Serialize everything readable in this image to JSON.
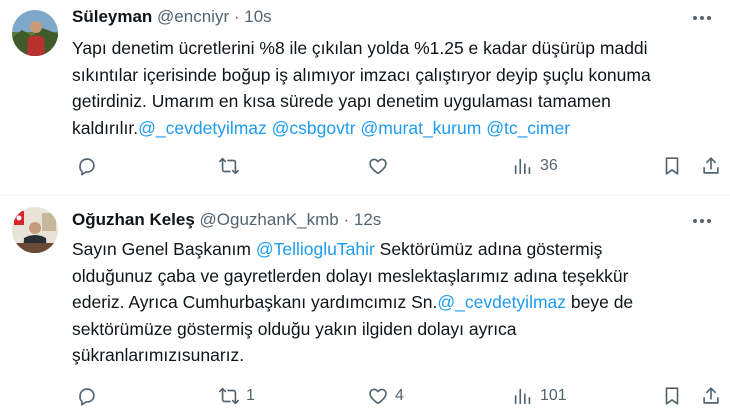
{
  "tweets": [
    {
      "name": "Süleyman",
      "handle": "@encniyr",
      "dot": "·",
      "time": "10s",
      "text_lines": [
        [
          {
            "t": "Yapı denetim ücretlerini %8 ile çıkılan yolda %1.25 e kadar düşürüp maddi"
          }
        ],
        [
          {
            "t": "sıkıntılar içerisinde boğup iş alımıyor imzacı çalıştıryor deyip şuçlu konuma"
          }
        ],
        [
          {
            "t": "getirdiniz. Umarım en kısa sürede yapı denetim uygulaması tamamen"
          }
        ],
        [
          {
            "t": "kaldırılır."
          },
          {
            "t": "@_cevdetyilmaz",
            "m": true
          },
          {
            "t": " "
          },
          {
            "t": "@csbgovtr",
            "m": true
          },
          {
            "t": " "
          },
          {
            "t": "@murat_kurum",
            "m": true
          },
          {
            "t": " "
          },
          {
            "t": "@tc_cimer",
            "m": true
          }
        ]
      ],
      "actions": {
        "reply_count": "",
        "retweet_count": "",
        "like_count": "",
        "views_count": "36"
      }
    },
    {
      "name": "Oğuzhan Keleş",
      "handle": "@OguzhanK_kmb",
      "dot": "·",
      "time": "12s",
      "text_lines": [
        [
          {
            "t": "Sayın Genel Başkanım "
          },
          {
            "t": "@TelliogluTahir",
            "m": true
          },
          {
            "t": " Sektörümüz adına göstermiş"
          }
        ],
        [
          {
            "t": "olduğunuz çaba ve gayretlerden dolayı meslektaşlarımız adına teşekkür"
          }
        ],
        [
          {
            "t": "ederiz. Ayrıca Cumhurbaşkanı yardımcımız Sn."
          },
          {
            "t": "@_cevdetyilmaz",
            "m": true
          },
          {
            "t": " beye de"
          }
        ],
        [
          {
            "t": "sektörümüze göstermiş olduğu yakın ilgiden dolayı ayrıca"
          }
        ],
        [
          {
            "t": "şükranlarımızısunarız."
          }
        ]
      ],
      "actions": {
        "reply_count": "",
        "retweet_count": "1",
        "like_count": "4",
        "views_count": "101"
      }
    }
  ],
  "colors": {
    "text": "#0f1419",
    "secondary": "#536471",
    "mention": "#1d9bf0",
    "divider": "#eff3f4"
  },
  "icons": [
    "reply-icon",
    "retweet-icon",
    "like-icon",
    "views-icon",
    "bookmark-icon",
    "share-icon",
    "more-icon"
  ]
}
